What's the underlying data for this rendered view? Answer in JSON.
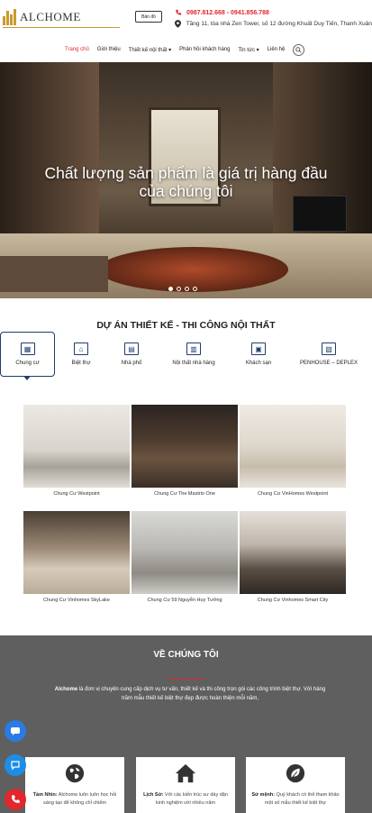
{
  "header": {
    "logo_text": "ALCHOME",
    "map_button": "Bản đồ",
    "phone": "0987.812.668 - 0941.856.788",
    "address": "Tầng 11, tòa nhà Zen Tower, số 12 đường Khuất Duy Tiến, Thanh Xuân"
  },
  "nav": {
    "items": [
      "Trang chủ",
      "Giới thiệu",
      "Thiết kế nội thất ▾",
      "Phản hồi khách hàng",
      "Tin tức ▾",
      "Liên hệ"
    ],
    "active_index": 0
  },
  "hero": {
    "title_line1": "Chất lượng sản phẩm là giá trị hàng đầu",
    "title_line2": "của chúng tôi",
    "slide_count": 4,
    "active_slide": 0
  },
  "projects": {
    "title": "DỰ ÁN THIẾT KẾ - THI CÔNG NỘI THẤT",
    "categories": [
      "Chung cư",
      "Biệt thự",
      "Nhà phố",
      "Nội thất nhà hàng",
      "Khách sạn",
      "PENHOUSE – DEPLEX"
    ],
    "active_category": 0,
    "items": [
      "Chung Cư Westpoint",
      "Chung Cư The Mastrio One",
      "Chung Cư VinHomes Westpoint",
      "Chung Cư Vinhomes SkyLake",
      "Chung Cư 59 Nguyễn Huy Tưởng",
      "Chung Cư Vinhomes Smart City"
    ]
  },
  "about": {
    "title": "VỀ CHÚNG TÔI",
    "brand": "Alchome",
    "text": " là đơn vị chuyên cung cấp dịch vụ tư vấn, thiết kế và thi công trọn gói các công trình biệt thự. Với hàng trăm mẫu thiết kế biệt thự đẹp được hoàn thiện mỗi năm,",
    "features": [
      {
        "icon": "globe-icon",
        "label": "Tầm Nhìn:",
        "text": " Alchome luôn luôn học hỏi sáng tạo để không chỉ chiếm"
      },
      {
        "icon": "home-icon",
        "label": "Lịch Sử:",
        "text": " Với các kiến trúc sư dày dặn kinh nghiệm với nhiều năm"
      },
      {
        "icon": "leaf-icon",
        "label": "Sứ mệnh:",
        "text": " Quý khách có thể tham khảo một số mẫu thiết kế biệt thự"
      }
    ]
  },
  "colors": {
    "accent": "#e0282e",
    "brand_gold": "#c99a2e",
    "navy": "#1f3d6b",
    "about_bg": "#5f5f5f"
  }
}
